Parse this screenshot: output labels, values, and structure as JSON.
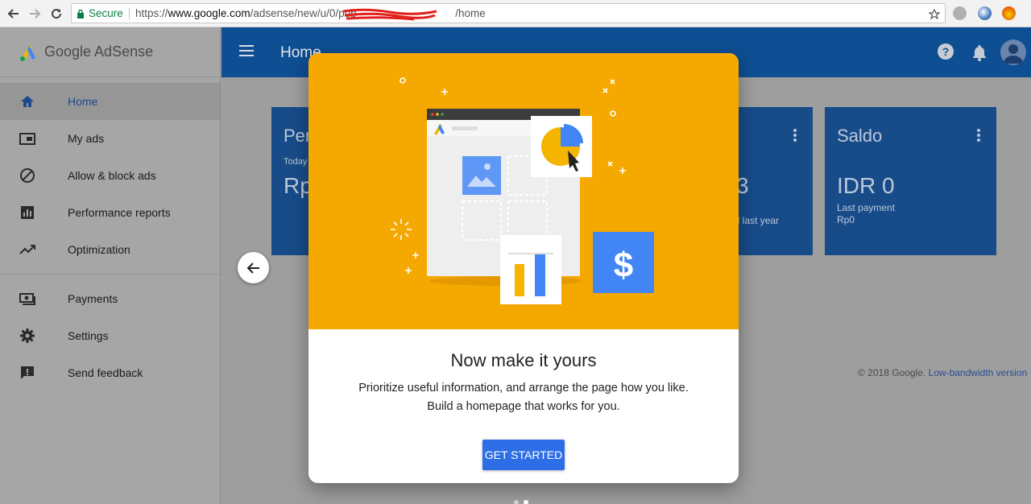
{
  "browser": {
    "secure_label": "Secure",
    "url_scheme": "https://",
    "url_host": "www.google.com",
    "url_path_start": "/adsense/new/u/0/pub-",
    "url_path_end": "/home",
    "url_redacted": "[redacted]"
  },
  "sidebar": {
    "brand": "Google AdSense",
    "items": [
      {
        "label": "Home",
        "icon": "home-icon",
        "active": true
      },
      {
        "label": "My ads",
        "icon": "ads-icon"
      },
      {
        "label": "Allow & block ads",
        "icon": "block-icon"
      },
      {
        "label": "Performance reports",
        "icon": "bar-chart-icon"
      },
      {
        "label": "Optimization",
        "icon": "trending-icon"
      },
      {
        "label": "Payments",
        "icon": "payments-icon"
      },
      {
        "label": "Settings",
        "icon": "gear-icon"
      },
      {
        "label": "Send feedback",
        "icon": "feedback-icon"
      }
    ]
  },
  "header": {
    "title": "Home"
  },
  "cards": {
    "card1": {
      "title": "Per",
      "sub": "Today",
      "value": "Rp"
    },
    "card2": {
      "value": "3",
      "sub": "od last year"
    },
    "card3": {
      "title": "Saldo",
      "value": "IDR 0",
      "last_payment_label": "Last payment",
      "last_payment_value": "Rp0"
    }
  },
  "footer": {
    "copyright": "© 2018 Google.",
    "link": "Low-bandwidth version"
  },
  "modal": {
    "title": "Now make it yours",
    "line1": "Prioritize useful information, and arrange the page how you like.",
    "line2": "Build a homepage that works for you.",
    "cta": "GET STARTED"
  },
  "colors": {
    "hero": "#f5a800",
    "appbar": "#0e4e93",
    "card": "#174c89",
    "cta": "#2d6ee6"
  }
}
